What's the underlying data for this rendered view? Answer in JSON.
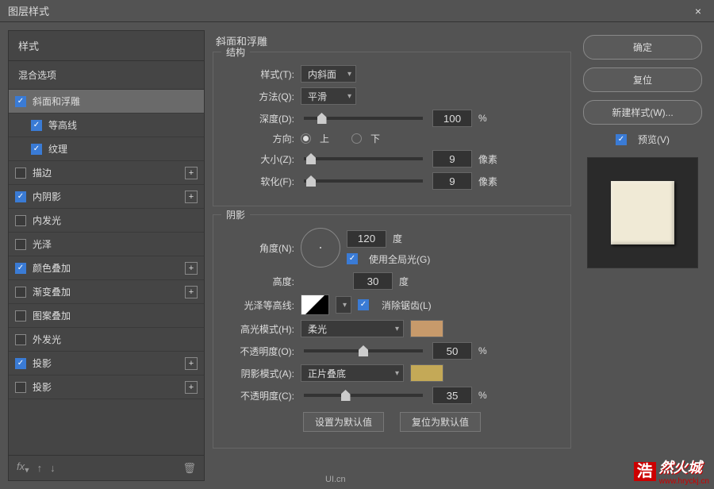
{
  "dialog": {
    "title": "图层样式",
    "close": "×"
  },
  "left": {
    "styles_header": "样式",
    "blend_options": "混合选项",
    "items": [
      {
        "label": "斜面和浮雕",
        "checked": true,
        "selected": true,
        "plus": false,
        "indent": false
      },
      {
        "label": "等高线",
        "checked": true,
        "selected": false,
        "plus": false,
        "indent": true
      },
      {
        "label": "纹理",
        "checked": true,
        "selected": false,
        "plus": false,
        "indent": true
      },
      {
        "label": "描边",
        "checked": false,
        "selected": false,
        "plus": true,
        "indent": false
      },
      {
        "label": "内阴影",
        "checked": true,
        "selected": false,
        "plus": true,
        "indent": false
      },
      {
        "label": "内发光",
        "checked": false,
        "selected": false,
        "plus": false,
        "indent": false
      },
      {
        "label": "光泽",
        "checked": false,
        "selected": false,
        "plus": false,
        "indent": false
      },
      {
        "label": "颜色叠加",
        "checked": true,
        "selected": false,
        "plus": true,
        "indent": false
      },
      {
        "label": "渐变叠加",
        "checked": false,
        "selected": false,
        "plus": true,
        "indent": false
      },
      {
        "label": "图案叠加",
        "checked": false,
        "selected": false,
        "plus": false,
        "indent": false
      },
      {
        "label": "外发光",
        "checked": false,
        "selected": false,
        "plus": false,
        "indent": false
      },
      {
        "label": "投影",
        "checked": true,
        "selected": false,
        "plus": true,
        "indent": false
      },
      {
        "label": "投影",
        "checked": false,
        "selected": false,
        "plus": true,
        "indent": false
      }
    ],
    "fx": "fx",
    "plus": "+"
  },
  "center": {
    "title": "斜面和浮雕",
    "structure": {
      "legend": "结构",
      "style_label": "样式(T):",
      "style_value": "内斜面",
      "technique_label": "方法(Q):",
      "technique_value": "平滑",
      "depth_label": "深度(D):",
      "depth_value": "100",
      "percent": "%",
      "direction_label": "方向:",
      "dir_up": "上",
      "dir_down": "下",
      "size_label": "大小(Z):",
      "size_value": "9",
      "pixels": "像素",
      "soften_label": "软化(F):",
      "soften_value": "9"
    },
    "shading": {
      "legend": "阴影",
      "angle_label": "角度(N):",
      "angle_value": "120",
      "degree": "度",
      "global_light": "使用全局光(G)",
      "altitude_label": "高度:",
      "altitude_value": "30",
      "gloss_label": "光泽等高线:",
      "antialias": "消除锯齿(L)",
      "highlight_mode_label": "高光模式(H):",
      "highlight_mode_value": "柔光",
      "highlight_color": "#c79a6b",
      "highlight_opacity_label": "不透明度(O):",
      "highlight_opacity_value": "50",
      "shadow_mode_label": "阴影模式(A):",
      "shadow_mode_value": "正片叠底",
      "shadow_color": "#c4a957",
      "shadow_opacity_label": "不透明度(C):",
      "shadow_opacity_value": "35"
    },
    "buttons": {
      "make_default": "设置为默认值",
      "reset_default": "复位为默认值"
    }
  },
  "right": {
    "ok": "确定",
    "reset": "复位",
    "new_style": "新建样式(W)...",
    "preview": "预览(V)"
  },
  "watermark": {
    "badge": "浩",
    "cn": "然火城",
    "url": "www.hryckj.cn"
  },
  "uilogo": "UI.cn"
}
